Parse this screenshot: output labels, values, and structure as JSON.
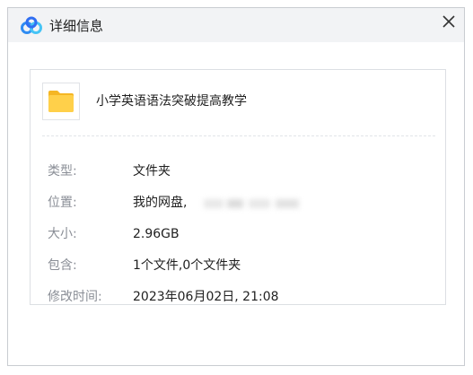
{
  "window": {
    "title": "详细信息",
    "app_icon": "baidu-netdisk-cloud-icon",
    "close_icon": "close-icon"
  },
  "item": {
    "icon": "folder-icon",
    "name": "小学英语语法突破提高教学"
  },
  "details": [
    {
      "label": "类型:",
      "value": "文件夹"
    },
    {
      "label": "位置:",
      "value": "我的网盘,"
    },
    {
      "label": "大小:",
      "value": "2.96GB"
    },
    {
      "label": "包含:",
      "value": "1个文件,0个文件夹"
    },
    {
      "label": "修改时间:",
      "value": "2023年06月02日, 21:08"
    }
  ],
  "colors": {
    "titlebar_bg": "#f2f3f5",
    "label": "#8a8e96",
    "value": "#1f1f1f",
    "folder": "#ffc83d",
    "brand_blue": "#2f8cf2"
  }
}
